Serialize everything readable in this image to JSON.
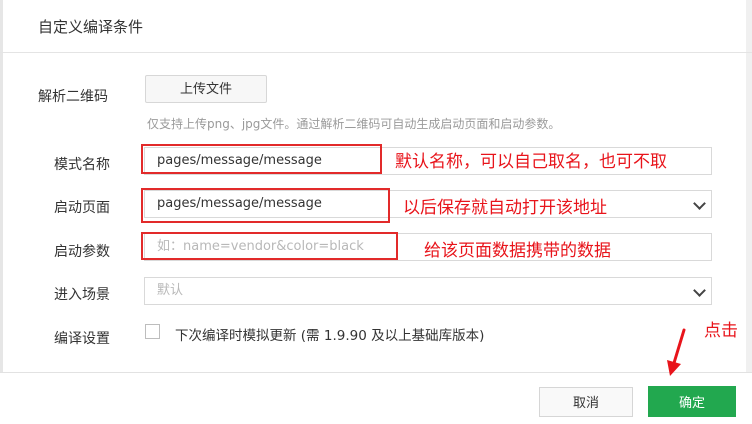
{
  "dialog": {
    "title": "自定义编译条件"
  },
  "form": {
    "qr_label": "解析二维码",
    "upload_button": "上传文件",
    "upload_hint": "仅支持上传png、jpg文件。通过解析二维码可自动生成启动页面和启动参数。",
    "mode_name_label": "模式名称",
    "mode_name_value": "pages/message/message",
    "start_page_label": "启动页面",
    "start_page_value": "pages/message/message",
    "start_params_label": "启动参数",
    "start_params_placeholder": "如：name=vendor&color=black",
    "scene_label": "进入场景",
    "scene_value": "默认",
    "compile_label": "编译设置",
    "compile_checkbox_label": "下次编译时模拟更新 (需 1.9.90 及以上基础库版本)"
  },
  "annotations": {
    "mode_name_note": "默认名称，可以自己取名，也可不取",
    "start_page_note": "以后保存就自动打开该地址",
    "start_params_note": "给该页面数据携带的数据",
    "click_note": "点击",
    "color": "#e8141b"
  },
  "footer": {
    "cancel_label": "取消",
    "confirm_label": "确定",
    "confirm_color": "#22a84f"
  }
}
